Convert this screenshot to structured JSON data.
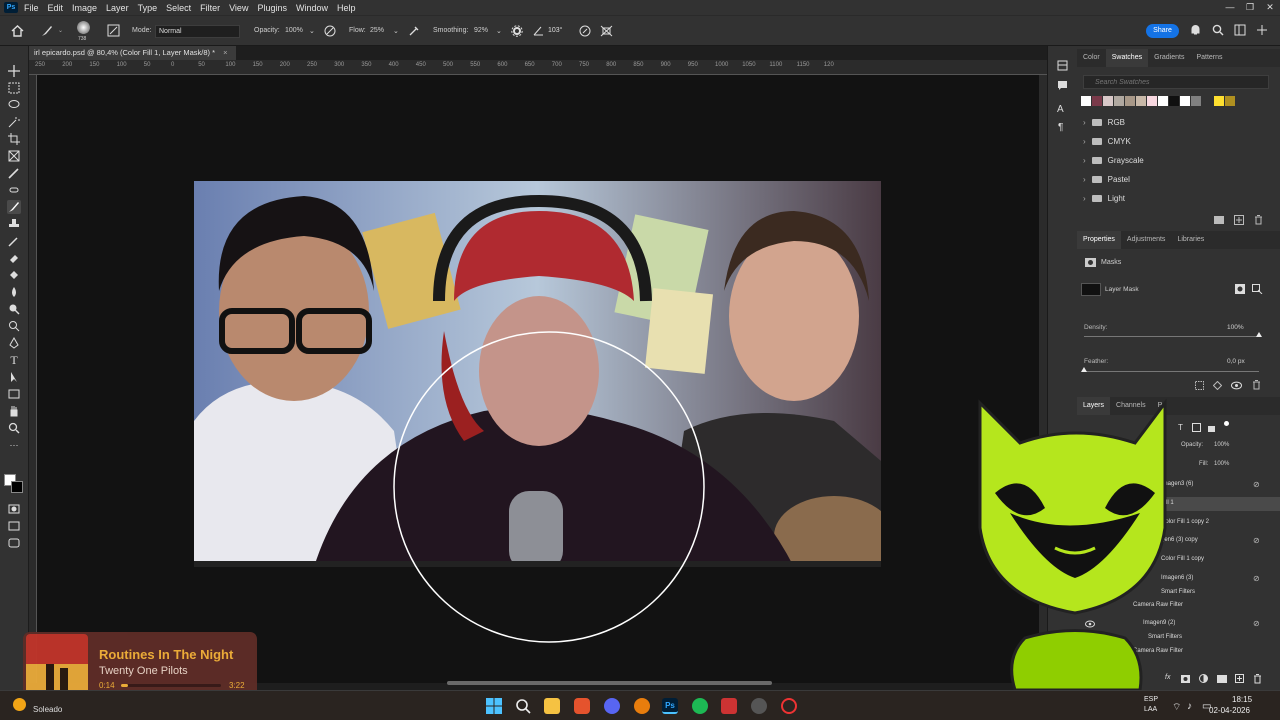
{
  "menubar": {
    "logo": "Ps",
    "items": [
      "File",
      "Edit",
      "Image",
      "Layer",
      "Type",
      "Select",
      "Filter",
      "View",
      "Plugins",
      "Window",
      "Help"
    ]
  },
  "optbar": {
    "brush_size": "738",
    "mode_label": "Mode:",
    "mode_value": "Normal",
    "opacity_label": "Opacity:",
    "opacity_value": "100%",
    "flow_label": "Flow:",
    "flow_value": "25%",
    "smoothing_label": "Smoothing:",
    "smoothing_value": "92%",
    "angle_value": "103°",
    "share_label": "Share"
  },
  "document": {
    "tab_title": "irl epicardo.psd @ 80,4% (Color Fill 1, Layer Mask/8) *",
    "close": "×"
  },
  "ruler": {
    "ticks": [
      "250",
      "200",
      "150",
      "100",
      "50",
      "0",
      "50",
      "100",
      "150",
      "200",
      "250",
      "300",
      "350",
      "400",
      "450",
      "500",
      "550",
      "600",
      "650",
      "700",
      "750",
      "800",
      "850",
      "900",
      "950",
      "1000",
      "1050",
      "1100",
      "1150",
      "120"
    ]
  },
  "swatches": {
    "tabs": [
      "Color",
      "Swatches",
      "Gradients",
      "Patterns"
    ],
    "active_tab": "Swatches",
    "search_placeholder": "Search Swatches",
    "colors": [
      "#ffffff",
      "#7a3a4a",
      "#d8c8c8",
      "#b0a8a0",
      "#a89888",
      "#c8b8a8",
      "#f8d8e0",
      "#ffffff",
      "#101010",
      "#ffffff",
      "#808080",
      "#ffe030",
      "#b09020"
    ],
    "folders": [
      "RGB",
      "CMYK",
      "Grayscale",
      "Pastel",
      "Light"
    ]
  },
  "properties": {
    "tabs": [
      "Properties",
      "Adjustments",
      "Libraries"
    ],
    "active_tab": "Properties",
    "section": "Masks",
    "mask_label": "Layer Mask",
    "density_label": "Density:",
    "density_value": "100%",
    "density_level": 1.0,
    "feather_label": "Feather:",
    "feather_value": "0,0 px",
    "feather_level": 0.0
  },
  "layers": {
    "tabs": [
      "Layers",
      "Channels",
      "Pa"
    ],
    "active_tab": "Layers",
    "opacity_label": "Opacity:",
    "opacity_value": "100%",
    "fill_label": "Fill:",
    "fill_value": "100%",
    "items": [
      "Imagen3 (6)",
      "Fill 1",
      "Color Fill 1 copy 2",
      "gen6 (3) copy",
      "Color Fill 1 copy",
      "Imagen6 (3)",
      "Smart Filters",
      "Camera Raw Filter",
      "Imagen9 (2)",
      "Smart Filters",
      "Camera Raw Filter"
    ]
  },
  "music": {
    "title": "Routines In The Night",
    "artist": "Twenty One Pilots",
    "elapsed": "0:14",
    "duration": "3:22",
    "progress": 0.07
  },
  "taskbar": {
    "weather": "Soleado",
    "lang_top": "ESP",
    "lang_bottom": "LAA",
    "time": "18:15",
    "date": "02-04-2026"
  },
  "colors": {
    "accent": "#1473e6",
    "mascot": "#b5e61d",
    "music_title": "#f4b23a"
  }
}
